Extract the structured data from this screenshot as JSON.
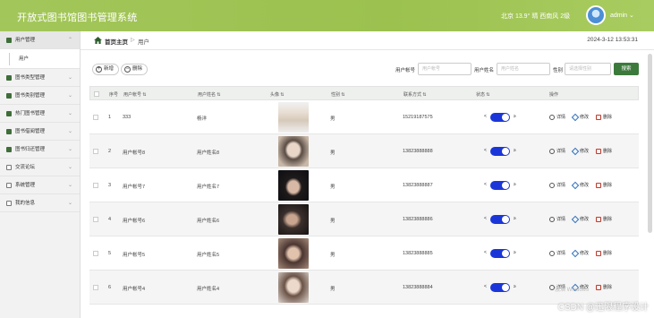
{
  "header": {
    "title": "开放式图书馆图书管理系统",
    "weather": "北京 13.9° 晴 西南风 2级",
    "user": "admin ⌄"
  },
  "sidebar": {
    "items": [
      {
        "label": "用户管理",
        "active": true
      },
      {
        "label": "图书类型管理"
      },
      {
        "label": "图书类别管理"
      },
      {
        "label": "热门图书管理"
      },
      {
        "label": "图书借阅管理"
      },
      {
        "label": "图书归还管理"
      },
      {
        "label": "交流论坛"
      },
      {
        "label": "系统管理"
      },
      {
        "label": "我的信息"
      }
    ],
    "submenu": "用户"
  },
  "breadcrumb": {
    "home": "首页主页",
    "sep": "▷",
    "current": "用户",
    "time": "2024-3-12 13:53:31"
  },
  "toolbar": {
    "add": "新增",
    "delete": "删除",
    "f1_label": "用户帐号",
    "f1_placeholder": "用户帐号",
    "f2_label": "用户姓名",
    "f2_placeholder": "用户姓名",
    "f3_label": "性别",
    "f3_placeholder": "请选择性别",
    "search": "搜索"
  },
  "table": {
    "headers": [
      "序号",
      "用户帐号 ⇅",
      "用户姓名 ⇅",
      "头像 ⇅",
      "性别 ⇅",
      "联系方式 ⇅",
      "状态 ⇅",
      "操作"
    ],
    "rows": [
      {
        "no": "1",
        "account": "333",
        "name": "杨洋",
        "gender": "男",
        "phone": "15219187575"
      },
      {
        "no": "2",
        "account": "用户帐号8",
        "name": "用户姓名8",
        "gender": "男",
        "phone": "13823888888"
      },
      {
        "no": "3",
        "account": "用户帐号7",
        "name": "用户姓名7",
        "gender": "男",
        "phone": "13823888887"
      },
      {
        "no": "4",
        "account": "用户帐号6",
        "name": "用户姓名6",
        "gender": "男",
        "phone": "13823888886"
      },
      {
        "no": "5",
        "account": "用户帐号5",
        "name": "用户姓名5",
        "gender": "男",
        "phone": "13823888885"
      },
      {
        "no": "6",
        "account": "用户帐号4",
        "name": "用户姓名4",
        "gender": "男",
        "phone": "13823888884"
      }
    ],
    "detail": "详情",
    "edit": "修改",
    "remove": "删除"
  },
  "watermark": "CSDN @迅限程序设计",
  "activate": "激活 Windows"
}
